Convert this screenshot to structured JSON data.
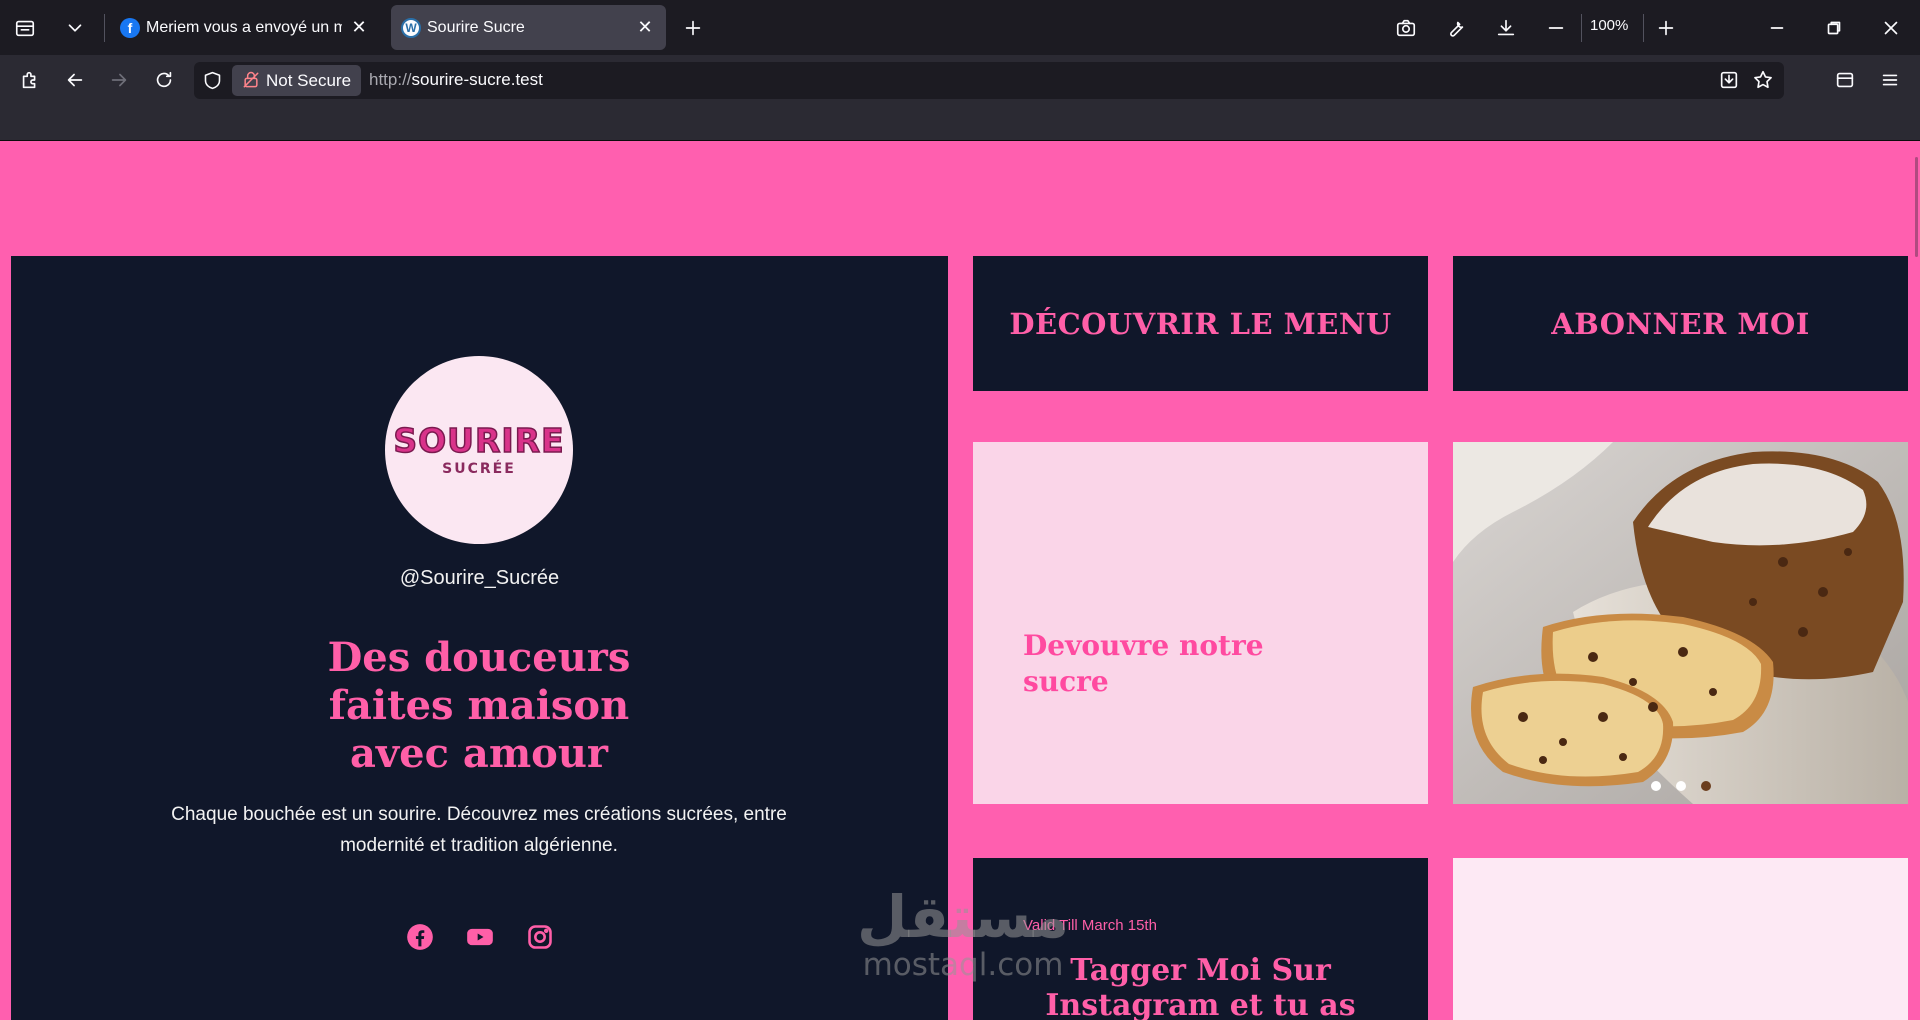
{
  "browser": {
    "tabs": [
      {
        "title": "Meriem vous a envoyé un mess",
        "favicon": "facebook-icon",
        "active": false
      },
      {
        "title": "Sourire Sucre",
        "favicon": "wordpress-icon",
        "active": true
      }
    ],
    "zoom": "100%",
    "security_label": "Not Secure",
    "url_protocol": "http://",
    "url_host": "sourire-sucre.test"
  },
  "colors": {
    "page_background": "#ff5faf",
    "panel_dark": "#10172a",
    "accent_pink": "#ff5fa8",
    "card_light": "#fad5e8"
  },
  "hero": {
    "logo_main": "SOURIRE",
    "logo_sub": "SUCRÉE",
    "handle": "@Sourire_Sucrée",
    "headline_lines": [
      "Des douceurs",
      "faites maison",
      "avec amour"
    ],
    "description_lines": [
      "Chaque bouchée est un sourire. Découvrez mes créations sucrées, entre",
      "modernité et tradition algérienne."
    ],
    "socials": [
      "facebook-icon",
      "youtube-icon",
      "instagram-icon"
    ]
  },
  "cards": {
    "menu_button": "DÉCOUVRIR LE MENU",
    "subscribe_button": "ABONNER MOI",
    "promo_title_lines": [
      "Devouvre notre",
      "sucre"
    ],
    "carousel": {
      "slides": 3,
      "active_index": 2,
      "image": "cake-loaf-photo"
    },
    "insta_valid": "Valid Till March 15th",
    "insta_title_lines": [
      "Tagger Moi Sur",
      "Instagram et tu as"
    ]
  },
  "watermark": {
    "arabic": "مستقل",
    "latin": "mostaql.com"
  }
}
